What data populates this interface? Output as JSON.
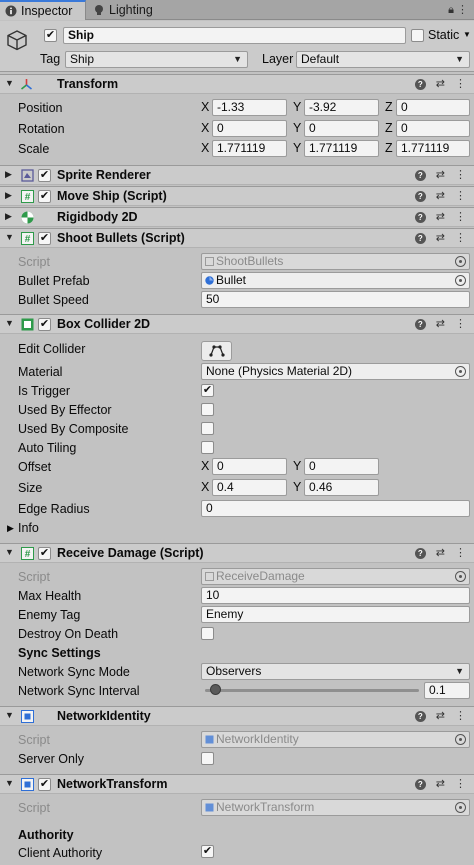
{
  "tabs": [
    {
      "label": "Inspector",
      "icon": "info-icon"
    },
    {
      "label": "Lighting",
      "icon": "lightbulb-icon"
    }
  ],
  "gameobject": {
    "active": true,
    "name": "Ship",
    "static_label": "Static",
    "static_checked": false,
    "tag_label": "Tag",
    "tag_value": "Ship",
    "layer_label": "Layer",
    "layer_value": "Default"
  },
  "transform": {
    "title": "Transform",
    "position": {
      "label": "Position",
      "x": "-1.33",
      "y": "-3.92",
      "z": "0"
    },
    "rotation": {
      "label": "Rotation",
      "x": "0",
      "y": "0",
      "z": "0"
    },
    "scale": {
      "label": "Scale",
      "x": "1.771119",
      "y": "1.771119",
      "z": "1.771119"
    }
  },
  "axis_labels": {
    "x": "X",
    "y": "Y",
    "z": "Z"
  },
  "sprite_renderer": {
    "title": "Sprite Renderer",
    "enabled": true
  },
  "move_ship": {
    "title": "Move Ship (Script)",
    "enabled": true
  },
  "rigidbody2d": {
    "title": "Rigidbody 2D"
  },
  "shoot_bullets": {
    "title": "Shoot Bullets (Script)",
    "enabled": true,
    "script_label": "Script",
    "script_value": "ShootBullets",
    "bullet_prefab_label": "Bullet Prefab",
    "bullet_prefab_value": "Bullet",
    "bullet_speed_label": "Bullet Speed",
    "bullet_speed_value": "50"
  },
  "box_collider": {
    "title": "Box Collider 2D",
    "enabled": true,
    "edit_collider_label": "Edit Collider",
    "material_label": "Material",
    "material_value": "None (Physics Material 2D)",
    "is_trigger_label": "Is Trigger",
    "is_trigger": true,
    "used_by_effector_label": "Used By Effector",
    "used_by_effector": false,
    "used_by_composite_label": "Used By Composite",
    "used_by_composite": false,
    "auto_tiling_label": "Auto Tiling",
    "auto_tiling": false,
    "offset_label": "Offset",
    "offset_x": "0",
    "offset_y": "0",
    "size_label": "Size",
    "size_x": "0.4",
    "size_y": "0.46",
    "edge_radius_label": "Edge Radius",
    "edge_radius_value": "0",
    "info_label": "Info"
  },
  "receive_damage": {
    "title": "Receive Damage (Script)",
    "enabled": true,
    "script_label": "Script",
    "script_value": "ReceiveDamage",
    "max_health_label": "Max Health",
    "max_health_value": "10",
    "enemy_tag_label": "Enemy Tag",
    "enemy_tag_value": "Enemy",
    "destroy_on_death_label": "Destroy On Death",
    "destroy_on_death": false,
    "sync_settings_label": "Sync Settings",
    "sync_mode_label": "Network Sync Mode",
    "sync_mode_value": "Observers",
    "sync_interval_label": "Network Sync Interval",
    "sync_interval_value": "0.1",
    "sync_interval_fraction": 0.05
  },
  "network_identity": {
    "title": "NetworkIdentity",
    "script_label": "Script",
    "script_value": "NetworkIdentity",
    "server_only_label": "Server Only",
    "server_only": false
  },
  "network_transform": {
    "title": "NetworkTransform",
    "enabled": true,
    "script_label": "Script",
    "script_value": "NetworkTransform",
    "authority_label": "Authority",
    "client_authority_label": "Client Authority",
    "client_authority": true
  },
  "colors": {
    "background": "#c2c2c2",
    "header": "#cbcbcb",
    "tab_accent": "#3a79d9",
    "transform_red": "#d23b3b",
    "script_green": "#2e9a4a",
    "network_blue": "#2f6fd6"
  }
}
